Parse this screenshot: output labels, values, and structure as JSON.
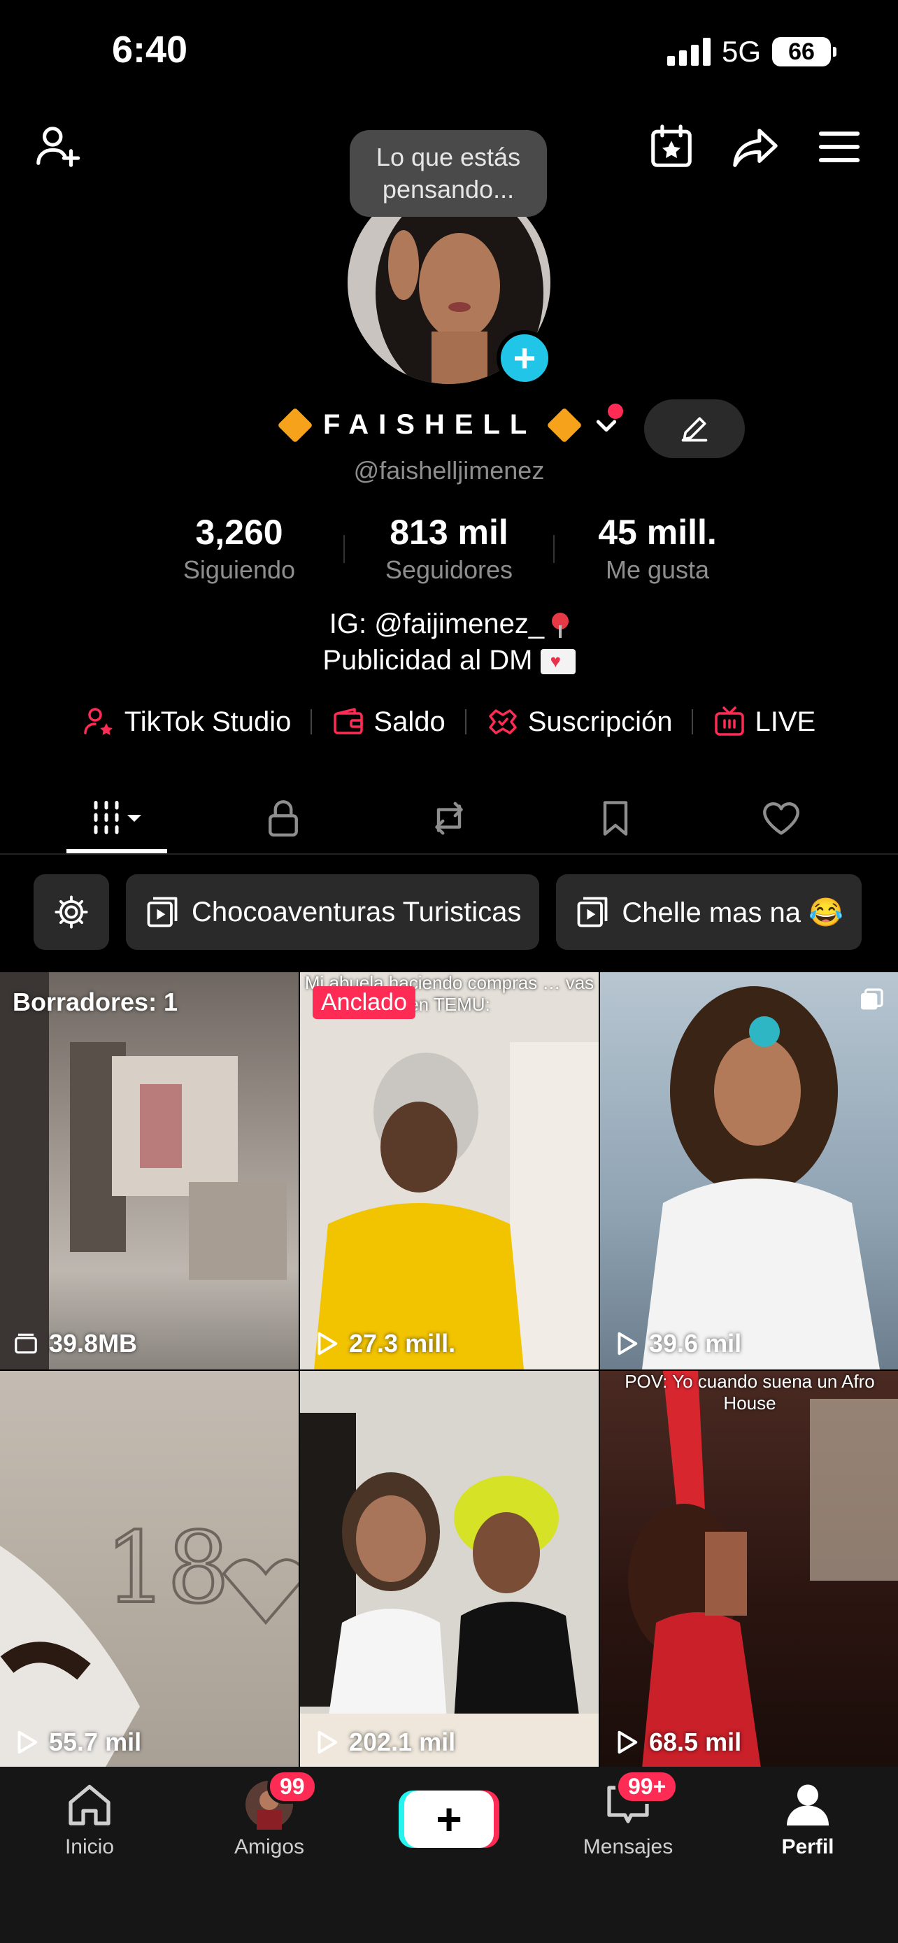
{
  "status": {
    "time": "6:40",
    "network": "5G",
    "battery": "66"
  },
  "bubble": {
    "line1": "Lo que estás",
    "line2": "pensando..."
  },
  "profile": {
    "name": "FAISHELL",
    "handle": "@faishelljimenez"
  },
  "stats": [
    {
      "value": "3,260",
      "label": "Siguiendo"
    },
    {
      "value": "813 mil",
      "label": "Seguidores"
    },
    {
      "value": "45 mill.",
      "label": "Me gusta"
    }
  ],
  "bio": {
    "line1": "IG: @faijimenez_",
    "line2": "Publicidad al DM"
  },
  "links": [
    {
      "label": "TikTok Studio",
      "icon": "person-star-icon"
    },
    {
      "label": "Saldo",
      "icon": "wallet-icon"
    },
    {
      "label": "Suscripción",
      "icon": "subscription-icon"
    },
    {
      "label": "LIVE",
      "icon": "live-tv-icon"
    }
  ],
  "tabs": [
    "videos-grid-icon",
    "lock-icon",
    "repost-icon",
    "bookmark-icon",
    "heart-icon"
  ],
  "playlists": [
    {
      "label": "Chocoaventuras Turisticas"
    },
    {
      "label": "Chelle mas na 😂"
    }
  ],
  "grid": {
    "drafts_label": "Borradores: 1",
    "drafts_size": "39.8MB",
    "pinned_label": "Anclado",
    "caption_2": "Mi abuela haciendo compras … vas en TEMU:",
    "caption_6": "POV: Yo cuando suena un Afro House",
    "views": [
      "27.3 mill.",
      "39.6 mil",
      "55.7 mil",
      "202.1 mil",
      "68.5 mil"
    ]
  },
  "nav": {
    "home": "Inicio",
    "friends": "Amigos",
    "friends_badge": "99",
    "messages": "Mensajes",
    "messages_badge": "99+",
    "profile": "Perfil"
  },
  "colors": {
    "accent": "#fe2c55",
    "cyan": "#25f4ee",
    "add": "#20c5e8",
    "diamond": "#f7a21b"
  }
}
